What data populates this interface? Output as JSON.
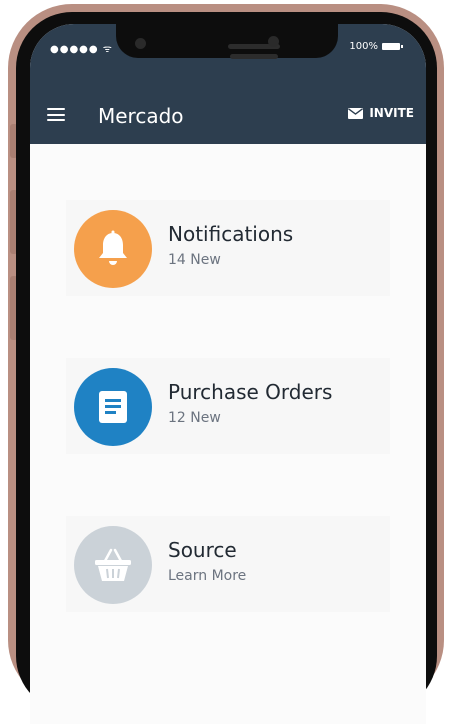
{
  "status_bar": {
    "signal": "●●●●● ᯤ",
    "battery": "100%"
  },
  "header": {
    "title": "Mercado",
    "invite_label": "INVITE"
  },
  "cards": [
    {
      "title": "Notifications",
      "subtitle": "14 New",
      "color": "#f5a04c",
      "icon": "bell-icon"
    },
    {
      "title": "Purchase Orders",
      "subtitle": "12 New",
      "color": "#1f82c4",
      "icon": "document-icon"
    },
    {
      "title": "Source",
      "subtitle": "Learn More",
      "color": "#cbd2d8",
      "icon": "basket-icon"
    }
  ],
  "colors": {
    "header_bg": "#2d3e4f",
    "frame": "#b98f82"
  }
}
